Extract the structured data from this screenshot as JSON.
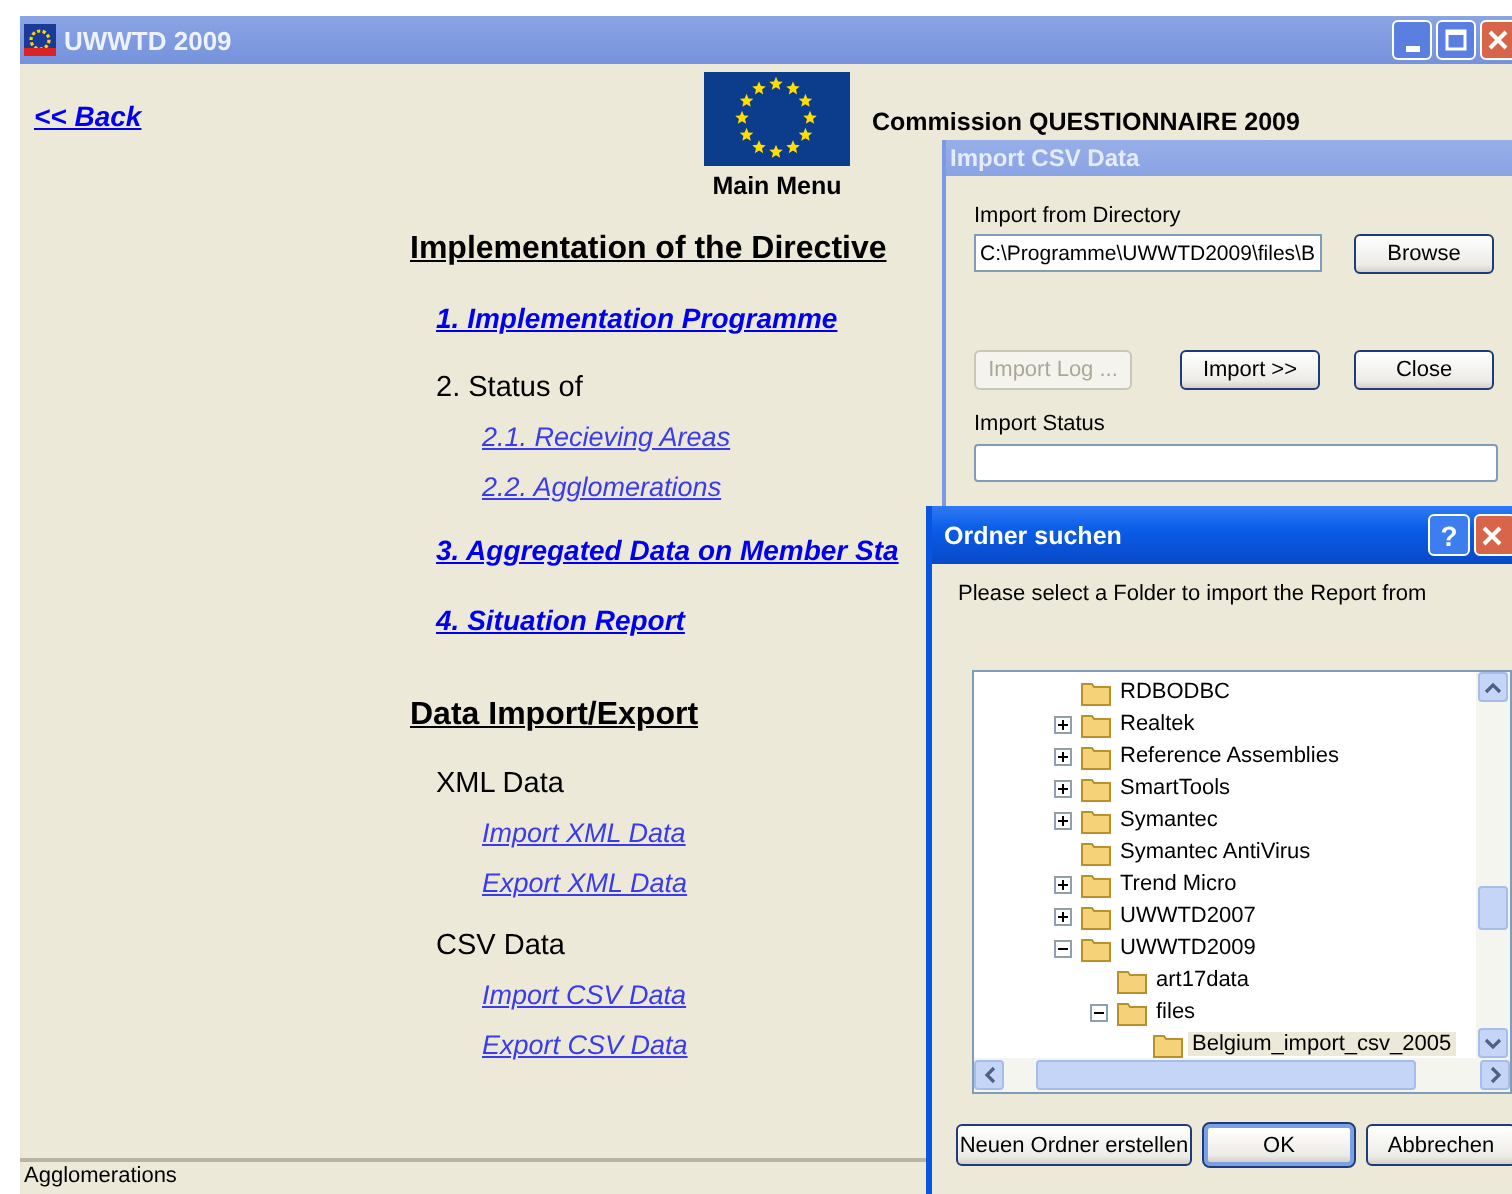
{
  "main_window": {
    "title": "UWWTD 2009",
    "back_link": "<< Back",
    "header": "Commission QUESTIONNAIRE 2009",
    "logo_caption": "Main Menu",
    "sections": [
      {
        "heading": "Implementation of the Directive",
        "items": [
          {
            "kind": "link",
            "label": "1. Implementation Programme"
          },
          {
            "kind": "group",
            "label": "2. Status of",
            "children": [
              {
                "label": "2.1. Recieving Areas"
              },
              {
                "label": "2.2. Agglomerations"
              }
            ]
          },
          {
            "kind": "link",
            "label": "3. Aggregated Data on Member Sta"
          },
          {
            "kind": "link",
            "label": "4. Situation Report"
          }
        ]
      },
      {
        "heading": "Data Import/Export",
        "items": [
          {
            "kind": "group",
            "label": "XML Data",
            "children": [
              {
                "label": "Import XML Data"
              },
              {
                "label": "Export XML Data"
              }
            ]
          },
          {
            "kind": "group",
            "label": "CSV Data",
            "children": [
              {
                "label": "Import CSV Data"
              },
              {
                "label": "Export CSV Data"
              }
            ]
          }
        ]
      }
    ],
    "status_bar": "Agglomerations"
  },
  "import_dialog": {
    "title": "Import CSV Data",
    "directory_label": "Import from Directory",
    "directory_value": "C:\\Programme\\UWWTD2009\\files\\B",
    "browse_button": "Browse",
    "buttons": [
      {
        "label": "Import Log ...",
        "disabled": true
      },
      {
        "label": "Import >>",
        "disabled": false
      },
      {
        "label": "Close",
        "disabled": false
      }
    ],
    "status_label": "Import Status"
  },
  "folder_dialog": {
    "title": "Ordner suchen",
    "help_button": "?",
    "prompt": "Please select a Folder to import the Report from",
    "tree": [
      {
        "label": "RDBODBC",
        "kind": "leaf",
        "selected": false
      },
      {
        "label": "Realtek",
        "kind": "branch",
        "expanded": false,
        "selected": false
      },
      {
        "label": "Reference Assemblies",
        "kind": "branch",
        "expanded": false,
        "selected": false
      },
      {
        "label": "SmartTools",
        "kind": "branch",
        "expanded": false,
        "selected": false
      },
      {
        "label": "Symantec",
        "kind": "branch",
        "expanded": false,
        "selected": false
      },
      {
        "label": "Symantec AntiVirus",
        "kind": "leaf",
        "selected": false
      },
      {
        "label": "Trend Micro",
        "kind": "branch",
        "expanded": false,
        "selected": false
      },
      {
        "label": "UWWTD2007",
        "kind": "branch",
        "expanded": false,
        "selected": false
      },
      {
        "label": "UWWTD2009",
        "kind": "branch",
        "expanded": true,
        "selected": false,
        "children": [
          {
            "label": "art17data",
            "kind": "leaf",
            "selected": false
          },
          {
            "label": "files",
            "kind": "branch",
            "expanded": true,
            "selected": false,
            "children": [
              {
                "label": "Belgium_import_csv_2005",
                "kind": "leaf",
                "selected": true
              }
            ]
          }
        ]
      }
    ],
    "buttons": [
      {
        "label": "Neuen Ordner erstellen",
        "default": false
      },
      {
        "label": "OK",
        "default": true
      },
      {
        "label": "Abbrechen",
        "default": false
      }
    ]
  }
}
